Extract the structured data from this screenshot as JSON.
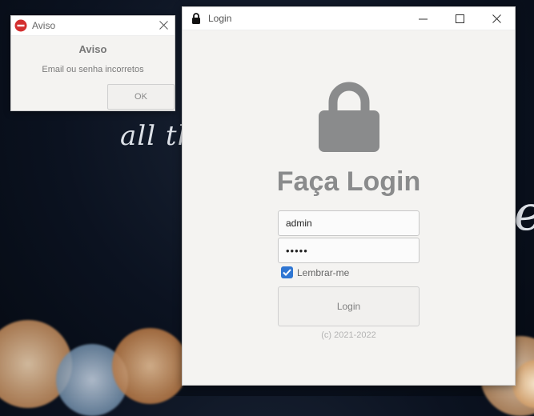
{
  "background": {
    "script_text_left": "all th",
    "script_text_right": "e"
  },
  "login_window": {
    "title": "Login",
    "controls": {
      "minimize": "—",
      "maximize": "☐",
      "close": "✕"
    },
    "heading": "Faça Login",
    "username_value": "admin",
    "password_value": "•••••",
    "remember_label": "Lembrar-me",
    "remember_checked": true,
    "login_button": "Login",
    "copyright": "(c) 2021-2022"
  },
  "aviso_dialog": {
    "title": "Aviso",
    "header": "Aviso",
    "message": "Email ou senha incorretos",
    "ok_button": "OK",
    "close": "✕"
  },
  "colors": {
    "accent": "#2f76d2",
    "error_icon": "#d32f2f",
    "lock_icon": "#8a8b8c"
  }
}
